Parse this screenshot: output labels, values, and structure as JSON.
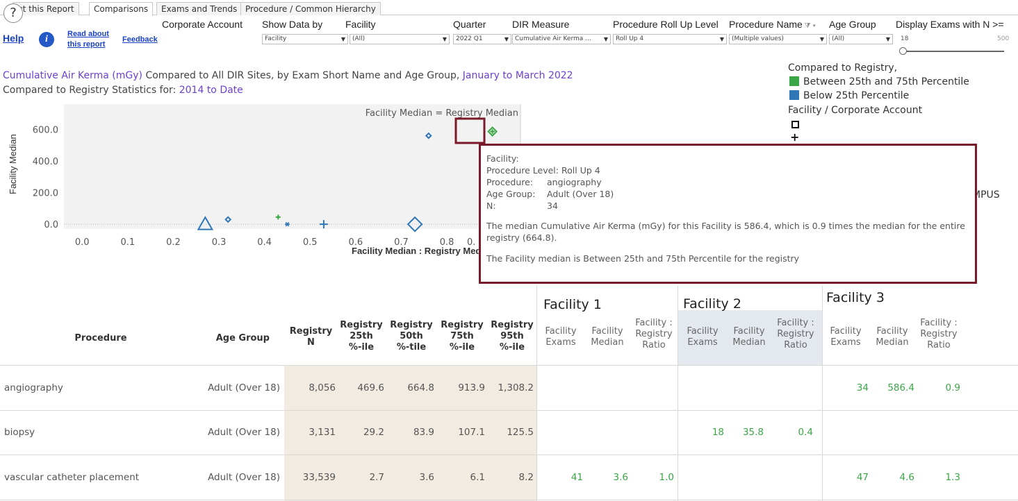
{
  "tabs": [
    {
      "label": "ut this Report"
    },
    {
      "label": "Comparisons"
    },
    {
      "label": "Exams and Trends"
    },
    {
      "label": "Procedure / Common Hierarchy"
    }
  ],
  "help_button": "?",
  "links": {
    "help": "Help",
    "read_about_1": "Read about",
    "read_about_2": "this report",
    "feedback": "Feedback"
  },
  "filters": {
    "corporate_account": {
      "label": "Corporate Account"
    },
    "show_data_by": {
      "label": "Show Data by",
      "value": "Facility"
    },
    "facility": {
      "label": "Facility",
      "value": "(All)"
    },
    "quarter": {
      "label": "Quarter",
      "value": "2022 Q1"
    },
    "dir_measure": {
      "label": "DIR Measure",
      "value": "Cumulative Air Kerma ..."
    },
    "roll_up": {
      "label": "Procedure Roll Up Level",
      "value": "Roll Up 4"
    },
    "procedure_name": {
      "label": "Procedure Name",
      "value": "(Multiple values)"
    },
    "age_group": {
      "label": "Age Group",
      "value": "(All)"
    },
    "display_exams": {
      "label": "Display Exams with N >=",
      "min": "18",
      "max": "500"
    }
  },
  "title": {
    "measure": "Cumulative Air Kerma (mGy)",
    "middle": " Compared to All DIR Sites, by Exam Short Name and Age Group, ",
    "period": "January to March 2022",
    "sub_prefix": "Compared to Registry Statistics for: ",
    "sub_period": "2014 to Date"
  },
  "legend": {
    "title": "Compared to Registry,",
    "items": [
      {
        "label": "Between 25th and 75th Percentile",
        "color": "#3aa645"
      },
      {
        "label": "Below 25th Percentile",
        "color": "#2f76b6"
      }
    ],
    "subtitle": "Facility / Corporate Account",
    "truncated": "MPUS"
  },
  "chart_data": {
    "type": "scatter",
    "xlabel": "Facility Median : Registry Median",
    "ylabel": "Facility Median",
    "annotation": "Facility Median = Registry Median",
    "x_ticks": [
      0.0,
      0.1,
      0.2,
      0.3,
      0.4,
      0.5,
      0.6,
      0.7,
      0.8
    ],
    "y_ticks": [
      0.0,
      200.0,
      400.0,
      600.0
    ],
    "xlim": [
      -0.04,
      0.96
    ],
    "ylim": [
      -30,
      760
    ],
    "points": [
      {
        "x": 0.27,
        "y": 0,
        "shape": "triangle",
        "color": "#2f76b6",
        "size": "large"
      },
      {
        "x": 0.32,
        "y": 30,
        "shape": "diamond",
        "color": "#2f76b6",
        "size": "small"
      },
      {
        "x": 0.43,
        "y": 45,
        "shape": "plus",
        "color": "#3aa645",
        "size": "small"
      },
      {
        "x": 0.45,
        "y": 0,
        "shape": "asterisk",
        "color": "#2f76b6",
        "size": "small"
      },
      {
        "x": 0.53,
        "y": 0,
        "shape": "plus",
        "color": "#2f76b6",
        "size": "medium"
      },
      {
        "x": 0.73,
        "y": 0,
        "shape": "diamond",
        "color": "#2f76b6",
        "size": "large"
      },
      {
        "x": 0.76,
        "y": 560,
        "shape": "diamond",
        "color": "#2f76b6",
        "size": "small"
      },
      {
        "x": 0.9,
        "y": 586.4,
        "shape": "diamond-plus",
        "color": "#3aa645",
        "size": "medium",
        "highlighted": true
      }
    ],
    "tick_partial": "0."
  },
  "tooltip": {
    "facility_label": "Facility:",
    "facility_value": "",
    "level_label": "Procedure Level:",
    "level_value": "Roll Up 4",
    "procedure_label": "Procedure:",
    "procedure_value": "angiography",
    "age_label": "Age Group:",
    "age_value": "Adult (Over 18)",
    "n_label": "N:",
    "n_value": "34",
    "msg_a": "The median ",
    "msg_measure": "Cumulative Air Kerma (mGy)",
    "msg_b": " for this Facility is ",
    "msg_value": "586.4",
    "msg_c": ", which is ",
    "msg_ratio": "0.9",
    "msg_d": " times the median for the entire registry (",
    "msg_reg": "664.8",
    "msg_e": ").",
    "msg2_a": "The Facility median is ",
    "msg2_b": "Between 25th and 75th Percentile",
    "msg2_c": " for the registry"
  },
  "table": {
    "facilities": [
      "Facility 1",
      "Facility 2",
      "Facility 3"
    ],
    "headers": {
      "procedure": "Procedure",
      "age_group": "Age Group",
      "reg_n": [
        "Registry",
        "N"
      ],
      "reg_25": [
        "Registry",
        "25th",
        "%-ile"
      ],
      "reg_50": [
        "Registry",
        "50th",
        "%-tile"
      ],
      "reg_75": [
        "Registry",
        "75th",
        "%-ile"
      ],
      "reg_95": [
        "Registry",
        "95th",
        "%-ile"
      ],
      "fac_exams": [
        "Facility",
        "Exams"
      ],
      "fac_median": [
        "Facility",
        "Median"
      ],
      "fac_ratio": [
        "Facility :",
        "Registry",
        "Ratio"
      ]
    },
    "rows": [
      {
        "procedure": "angiography",
        "age": "Adult (Over 18)",
        "reg_n": "8,056",
        "p25": "469.6",
        "p50": "664.8",
        "p75": "913.9",
        "p95": "1,308.2",
        "f1": [
          "",
          "",
          ""
        ],
        "f2": [
          "",
          "",
          ""
        ],
        "f3": [
          "34",
          "586.4",
          "0.9"
        ]
      },
      {
        "procedure": "biopsy",
        "age": "Adult (Over 18)",
        "reg_n": "3,131",
        "p25": "29.2",
        "p50": "83.9",
        "p75": "107.1",
        "p95": "125.5",
        "f1": [
          "",
          "",
          ""
        ],
        "f2": [
          "18",
          "35.8",
          "0.4"
        ],
        "f3": [
          "",
          "",
          ""
        ]
      },
      {
        "procedure": "vascular catheter placement",
        "age": "Adult (Over 18)",
        "reg_n": "33,539",
        "p25": "2.7",
        "p50": "3.6",
        "p75": "6.1",
        "p95": "8.2",
        "f1": [
          "41",
          "3.6",
          "1.0"
        ],
        "f2": [
          "",
          "",
          ""
        ],
        "f3": [
          "47",
          "4.6",
          "1.3"
        ]
      }
    ]
  }
}
